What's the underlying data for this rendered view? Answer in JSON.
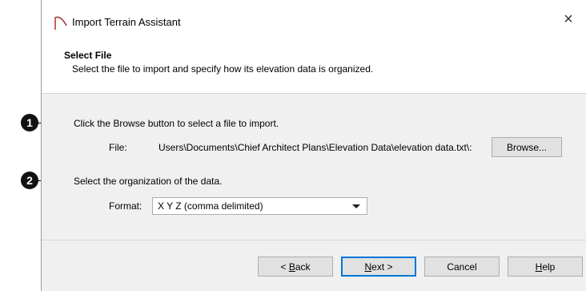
{
  "callouts": [
    "1",
    "2"
  ],
  "window": {
    "title": "Import Terrain Assistant",
    "close_glyph": "×"
  },
  "header": {
    "title": "Select File",
    "subtitle": "Select the file to import and specify how its elevation data is organized."
  },
  "step1": {
    "instruction": "Click the Browse button to select a file to import.",
    "file_label": "File:",
    "file_path": ":\\Users\\Documents\\Chief Architect Plans\\Elevation Data\\elevation data.txt",
    "browse_label": "Browse..."
  },
  "step2": {
    "instruction": "Select the organization of the data.",
    "format_label": "Format:",
    "format_value": "X Y Z (comma delimited)"
  },
  "buttons": {
    "back_prefix": "< ",
    "back_accel": "B",
    "back_rest": "ack",
    "next_accel": "N",
    "next_rest": "ext >",
    "cancel": "Cancel",
    "help_accel": "H",
    "help_rest": "elp"
  }
}
